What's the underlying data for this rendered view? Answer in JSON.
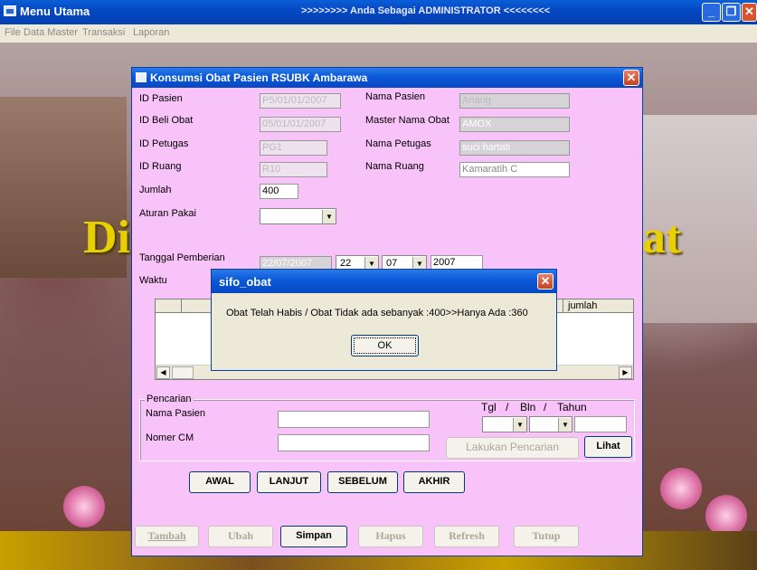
{
  "main_window": {
    "title": "Menu Utama",
    "center_text": ">>>>>>>> Anda Sebagai ADMINISTRATOR <<<<<<<<",
    "menu": [
      "File",
      "Data Master",
      "Transaksi",
      "Laporan"
    ]
  },
  "background": {
    "left_text": "Di",
    "right_text": "at"
  },
  "dialog": {
    "title": "Konsumsi Obat Pasien RSUBK Ambarawa",
    "fields": {
      "id_pasien": {
        "label": "ID Pasien",
        "value": "P5/01/01/2007"
      },
      "nama_pasien": {
        "label": "Nama Pasien",
        "value": "Anang"
      },
      "id_beli_obat": {
        "label": "ID Beli Obat",
        "value": "05/01/01/2007"
      },
      "master_nama_obat": {
        "label": "Master Nama Obat",
        "value": "AMOX"
      },
      "id_petugas": {
        "label": "ID Petugas",
        "value": "PG1"
      },
      "nama_petugas": {
        "label": "Nama Petugas",
        "value": "suci hartati"
      },
      "id_ruang": {
        "label": "ID Ruang",
        "value": "R10"
      },
      "nama_ruang": {
        "label": "Nama Ruang",
        "value": "Kamaratih C"
      },
      "jumlah": {
        "label": "Jumlah",
        "value": "400"
      },
      "aturan_pakai": {
        "label": "Aturan Pakai",
        "value": ""
      },
      "tanggal_pemberian": {
        "label": "Tanggal Pemberian",
        "value": "22/07/2007",
        "day": "22",
        "month": "07",
        "year": "2007"
      },
      "waktu": {
        "label": "Waktu"
      }
    },
    "grid": {
      "last_column_header": "jumlah"
    },
    "search": {
      "group_label": "Pencarian",
      "nama_pasien_label": "Nama Pasien",
      "nomer_cm_label": "Nomer CM",
      "date_header_tgl": "Tgl",
      "date_header_sep1": "/",
      "date_header_bln": "Bln",
      "date_header_sep2": "/",
      "date_header_tahun": "Tahun",
      "search_button": "Lakukan Pencarian",
      "view_button": "Lihat"
    },
    "nav_buttons": {
      "first": "AWAL",
      "next": "LANJUT",
      "prev": "SEBELUM",
      "last": "AKHIR"
    },
    "action_buttons": {
      "add": "Tambah",
      "edit": "Ubah",
      "save": "Simpan",
      "delete": "Hapus",
      "refresh": "Refresh",
      "close": "Tutup"
    }
  },
  "message_box": {
    "title": "sifo_obat",
    "message": "Obat Telah Habis / Obat Tidak ada sebanyak :400>>Hanya Ada :360",
    "ok_button": "OK"
  },
  "colors": {
    "dialog_bg": "#f8c3f8",
    "titlebar": "#0a58d8",
    "desktop_text": "#e8d000"
  }
}
